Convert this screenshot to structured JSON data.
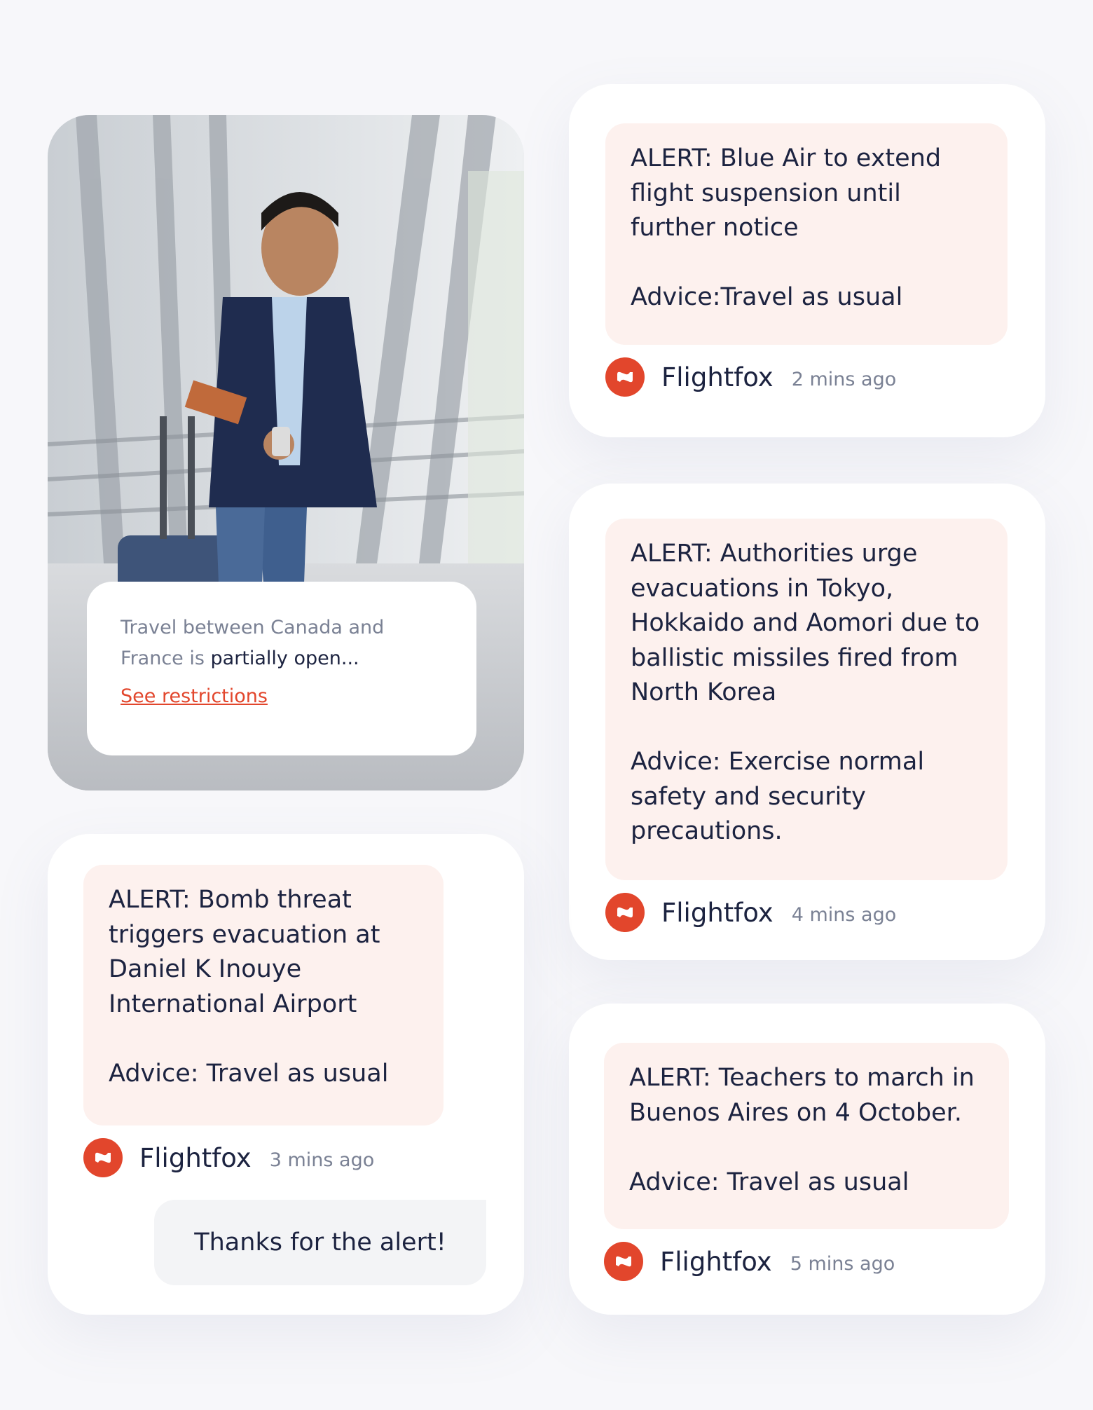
{
  "photo_card": {
    "info_text_prefix": "Travel between Canada and France is ",
    "info_text_emphasis": "partially open...",
    "link_label": "See restrictions"
  },
  "alerts": [
    {
      "text": "ALERT: Blue Air to extend flight suspension until further notice\n\nAdvice:Travel as usual",
      "sender": "Flightfox",
      "time": "2 mins ago"
    },
    {
      "text": "ALERT: Authorities urge evacuations in Tokyo, Hokkaido and Aomori due to ballistic missiles fired from North Korea\n\nAdvice: Exercise normal safety and security precautions.",
      "sender": "Flightfox",
      "time": "4 mins ago"
    },
    {
      "text": "ALERT: Bomb threat triggers evacuation at Daniel K Inouye International Airport\n\nAdvice: Travel as usual",
      "sender": "Flightfox",
      "time": "3 mins ago"
    },
    {
      "text": "ALERT: Teachers to march in Buenos Aires on 4 October.\n\nAdvice: Travel as usual",
      "sender": "Flightfox",
      "time": "5 mins ago"
    }
  ],
  "reply": {
    "text": "Thanks for the alert!"
  },
  "colors": {
    "accent": "#e2462c",
    "alert_bg": "#fdf1ee",
    "text_dark": "#1c2340",
    "text_muted": "#7a8194"
  },
  "icons": {
    "sender_logo": "flightfox-logo-icon"
  }
}
